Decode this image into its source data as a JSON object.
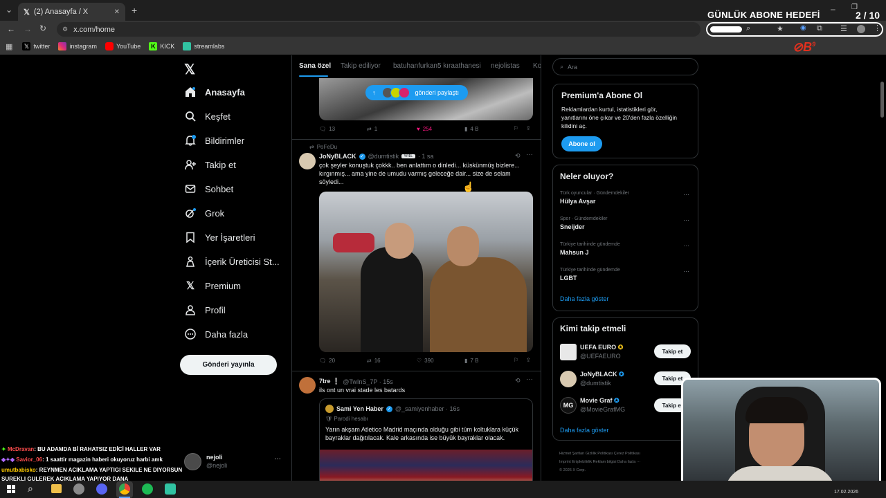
{
  "browser": {
    "tab_title": "(2) Anasayfa / X",
    "url": "x.com/home",
    "bookmarks": [
      "twitter",
      "instagram",
      "YouTube",
      "KICK",
      "streamlabs"
    ]
  },
  "stream_overlay": {
    "goal_label": "GÜNLÜK ABONE HEDEFİ",
    "goal_count": "2",
    "goal_total": "/ 10"
  },
  "nav": {
    "items": [
      {
        "label": "Anasayfa",
        "icon": "home-icon"
      },
      {
        "label": "Keşfet",
        "icon": "search-icon"
      },
      {
        "label": "Bildirimler",
        "icon": "bell-icon"
      },
      {
        "label": "Takip et",
        "icon": "add-person-icon"
      },
      {
        "label": "Sohbet",
        "icon": "mail-icon"
      },
      {
        "label": "Grok",
        "icon": "grok-icon"
      },
      {
        "label": "Yer İşaretleri",
        "icon": "bookmark-icon"
      },
      {
        "label": "İçerik Üreticisi St...",
        "icon": "creator-icon"
      },
      {
        "label": "Premium",
        "icon": "x-icon"
      },
      {
        "label": "Profil",
        "icon": "person-icon"
      },
      {
        "label": "Daha fazla",
        "icon": "more-circle-icon"
      }
    ],
    "post_button": "Gönderi yayınla",
    "account": {
      "name": "nejoli",
      "handle": "@nejoli"
    }
  },
  "feed": {
    "tabs": [
      "Sana özel",
      "Takip ediliyor",
      "batuhanfurkan5 kıraathanesi",
      "nejolistas",
      "Ko"
    ],
    "share_pill": "gönderi paylaştı",
    "tweet0_actions": {
      "replies": "13",
      "retweets": "1",
      "likes": "254",
      "views": "4 B"
    },
    "tweet1": {
      "context": "PoFeDu",
      "name": "JoNyBLACK",
      "handle": "@dumtistik",
      "badge": "Yntc.",
      "time": "· 1 sa",
      "text_lines": [
        "çok şeyler konuştuk çokkk.. ben anlattım o dinledi... küskünmüş bizlere...",
        "kırgınmış... ama yine de umudu varmış geleceğe dair... size de selam",
        "söyledi..."
      ],
      "actions": {
        "replies": "20",
        "retweets": "16",
        "likes": "390",
        "views": "7 B"
      }
    },
    "tweet2": {
      "name": "7tre ❕",
      "handle": "@TwInS_7P · 15s",
      "text": "ils ont un vrai stade les batards",
      "quote": {
        "name": "Sami Yen Haber",
        "handle": "@_samiyenhaber · 16s",
        "label": "Parodi hesabı",
        "text_lines": [
          "Yarın akşam Atletico Madrid maçında olduğu gibi tüm koltuklara küçük",
          "bayraklar dağıtılacak. Kale arkasında ise büyük bayraklar olacak."
        ]
      }
    }
  },
  "sidebar": {
    "search_placeholder": "Ara",
    "premium": {
      "title": "Premium'a Abone Ol",
      "desc_lines": [
        "Reklamlardan kurtul, istatistikleri gör,",
        "yanıtlarını öne çıkar ve 20'den fazla özelliğin",
        "kilidini aç."
      ],
      "button": "Abone ol"
    },
    "trends": {
      "title": "Neler oluyor?",
      "items": [
        {
          "sub": "Türk oyuncular · Gündemdekiler",
          "topic": "Hülya Avşar"
        },
        {
          "sub": "Spor · Gündemdekiler",
          "topic": "Sneijder"
        },
        {
          "sub": "Türkiye tarihinde gündemde",
          "topic": "Mahsun J"
        },
        {
          "sub": "Türkiye tarihinde gündemde",
          "topic": "LGBT"
        }
      ],
      "more": "Daha fazla göster"
    },
    "who_to_follow": {
      "title": "Kimi takip etmeli",
      "items": [
        {
          "name": "UEFA EURO",
          "handle": "@UEFAEURO"
        },
        {
          "name": "JoNyBLACK",
          "handle": "@dumtistik"
        },
        {
          "name": "Movie Graf",
          "handle": "@MovieGrafMG"
        }
      ],
      "follow_label": "Takip et",
      "more": "Daha fazla göster"
    },
    "footer_lines": [
      "Hizmet Şartları   Gizlilik Politikası   Çerez Politikası",
      "Imprint   Erişilebilirlik   Reklam bilgisi   Daha fazla ···",
      "© 2026 X Corp."
    ]
  },
  "chat": [
    {
      "user": "McDravan",
      "msg": ": BU ADAMDA Bİ RAHATSIZ EDİCİ HALLER VAR",
      "color": "#ff4d4d"
    },
    {
      "user": "Savior_06",
      "msg": ": 1 saattir magazin haberi okuyoruz harbi amk",
      "color": "#ff4d4d"
    },
    {
      "user": "umutbabisko",
      "msg": ": REYNMEN ACIKLAMA YAPTIGI SEKILE NE DIYORSUN",
      "color": "#ffcc00"
    },
    {
      "user": "",
      "msg": "SUREKLI GULEREK ACIKLAMA YAPIYOR DANA",
      "color": "#ffffff"
    }
  ],
  "taskbar": {
    "date": "17.02.2026"
  },
  "colors": {
    "accent": "#1d9bf0",
    "like": "#f91880",
    "bg": "#000000",
    "border": "#2f3336"
  }
}
